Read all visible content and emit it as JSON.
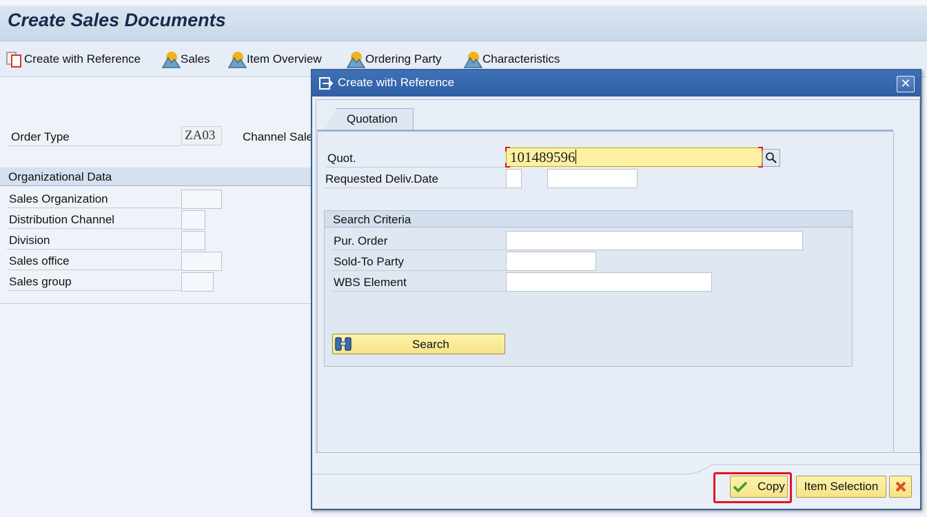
{
  "window": {
    "title": "Create Sales Documents"
  },
  "toolbar": {
    "items": [
      {
        "label": "Create with Reference",
        "icon": "document-copy-icon"
      },
      {
        "label": "Sales",
        "icon": "mountain-sun-icon"
      },
      {
        "label": "Item Overview",
        "icon": "mountain-sun-icon"
      },
      {
        "label": "Ordering Party",
        "icon": "mountain-sun-icon"
      },
      {
        "label": "Characteristics",
        "icon": "mountain-sun-icon"
      }
    ]
  },
  "main": {
    "order_type_label": "Order Type",
    "order_type_value": "ZA03",
    "channel_label": "Channel Sale",
    "org_group": {
      "title": "Organizational Data",
      "fields": [
        {
          "label": "Sales Organization",
          "value": ""
        },
        {
          "label": "Distribution Channel",
          "value": ""
        },
        {
          "label": "Division",
          "value": ""
        },
        {
          "label": "Sales office",
          "value": ""
        },
        {
          "label": "Sales group",
          "value": ""
        }
      ]
    }
  },
  "dialog": {
    "title": "Create with Reference",
    "close_symbol": "✕",
    "tab_label": "Quotation",
    "quot_label": "Quot.",
    "quot_value": "101489596",
    "req_deliv_label": "Requested Deliv.Date",
    "req_deliv_value_1": "",
    "req_deliv_value_2": "",
    "search_criteria": {
      "title": "Search Criteria",
      "pur_order_label": "Pur. Order",
      "pur_order_value": "",
      "sold_to_label": "Sold-To Party",
      "sold_to_value": "",
      "wbs_label": "WBS Element",
      "wbs_value": ""
    },
    "search_button": "Search",
    "buttons": {
      "copy": "Copy",
      "item_selection": "Item Selection"
    }
  },
  "colors": {
    "accent_dialog": "#2f5ea3",
    "highlight": "#e4161c",
    "active_field": "#fdf0a3",
    "button_yellow": "#f6e388"
  }
}
